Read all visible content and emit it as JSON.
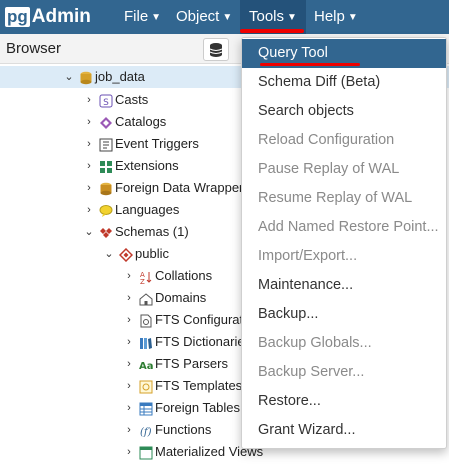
{
  "app": {
    "logo_pg": "pg",
    "logo_admin": "Admin"
  },
  "nav": {
    "file": "File",
    "object": "Object",
    "tools": "Tools",
    "help": "Help"
  },
  "browser": {
    "title": "Browser"
  },
  "tree": [
    {
      "label": "job_data",
      "icon": "database-icon",
      "chevron": "down"
    },
    {
      "label": "Casts",
      "icon": "casts-icon",
      "chevron": "right"
    },
    {
      "label": "Catalogs",
      "icon": "catalogs-icon",
      "chevron": "right"
    },
    {
      "label": "Event Triggers",
      "icon": "event-triggers-icon",
      "chevron": "right"
    },
    {
      "label": "Extensions",
      "icon": "extensions-icon",
      "chevron": "right"
    },
    {
      "label": "Foreign Data Wrapper",
      "icon": "foreign-data-wrapper-icon",
      "chevron": "right"
    },
    {
      "label": "Languages",
      "icon": "languages-icon",
      "chevron": "right"
    },
    {
      "label": "Schemas (1)",
      "icon": "schemas-icon",
      "chevron": "down"
    },
    {
      "label": "public",
      "icon": "schema-icon",
      "chevron": "down"
    },
    {
      "label": "Collations",
      "icon": "collations-icon",
      "chevron": "right"
    },
    {
      "label": "Domains",
      "icon": "domains-icon",
      "chevron": "right"
    },
    {
      "label": "FTS Configurati",
      "icon": "fts-config-icon",
      "chevron": "right"
    },
    {
      "label": "FTS Dictionarie",
      "icon": "fts-dictionaries-icon",
      "chevron": "right"
    },
    {
      "label": "FTS Parsers",
      "icon": "fts-parsers-icon",
      "chevron": "right"
    },
    {
      "label": "FTS Templates",
      "icon": "fts-templates-icon",
      "chevron": "right"
    },
    {
      "label": "Foreign Tables",
      "icon": "foreign-tables-icon",
      "chevron": "right"
    },
    {
      "label": "Functions",
      "icon": "functions-icon",
      "chevron": "right"
    },
    {
      "label": "Materialized Views",
      "icon": "materialized-views-icon",
      "chevron": "right"
    }
  ],
  "tools_menu": [
    {
      "label": "Query Tool",
      "state": "active"
    },
    {
      "label": "Schema Diff (Beta)",
      "state": "enabled"
    },
    {
      "label": "Search objects",
      "state": "enabled"
    },
    {
      "label": "Reload Configuration",
      "state": "disabled"
    },
    {
      "label": "Pause Replay of WAL",
      "state": "disabled"
    },
    {
      "label": "Resume Replay of WAL",
      "state": "disabled"
    },
    {
      "label": "Add Named Restore Point...",
      "state": "disabled"
    },
    {
      "label": "Import/Export...",
      "state": "disabled"
    },
    {
      "label": "Maintenance...",
      "state": "enabled"
    },
    {
      "label": "Backup...",
      "state": "enabled"
    },
    {
      "label": "Backup Globals...",
      "state": "disabled"
    },
    {
      "label": "Backup Server...",
      "state": "disabled"
    },
    {
      "label": "Restore...",
      "state": "enabled"
    },
    {
      "label": "Grant Wizard...",
      "state": "enabled"
    }
  ],
  "colors": {
    "navbar": "#326690",
    "menu_active": "#326690",
    "highlight": "#e00000"
  }
}
